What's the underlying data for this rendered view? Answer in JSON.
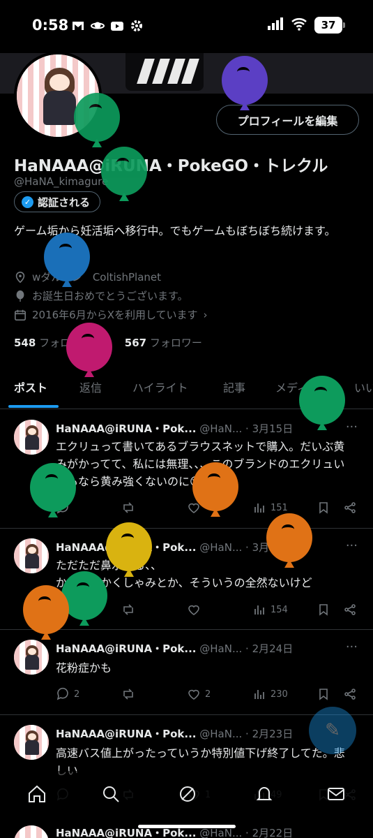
{
  "status_bar": {
    "time": "0:58",
    "battery": "37"
  },
  "profile": {
    "edit_button": "プロフィールを編集",
    "name": "HaNAAA@iRUNA・PokeGO・トレクル",
    "handle": "@HaNA_kimagure",
    "verified_label": "認証される",
    "bio": "ゲーム垢から妊活垢へ移行中。でもゲームもぼちぼち続けます。",
    "location": "wダルカン　ColtishPlanet",
    "birthday": "お誕生日おめでとうございます。",
    "joined": "2016年6月からXを利用しています",
    "following_count": "548",
    "following_label": "フォロー中",
    "followers_count": "567",
    "followers_label": "フォロワー"
  },
  "tabs": [
    "ポスト",
    "返信",
    "ハイライト",
    "記事",
    "メディア",
    "いい"
  ],
  "posts": [
    {
      "name": "HaNAAA@iRUNA・Pok...",
      "handle": "@HaN...",
      "date": "· 3月15日",
      "text": "エクリュって書いてあるブラウスネットで購入。だいぶ黄みがかってて、私には無理、、、このブランドのエクリュいつもなら黄み強くないのに😢",
      "views": "151",
      "likes": "",
      "replies": ""
    },
    {
      "name": "HaNAAA@iRUNA・Pok...",
      "handle": "@HaN...",
      "date": "· 3月1日",
      "text": "ただただ鼻水出る、、\nかゆいとかくしゃみとか、そういうの全然ないけど",
      "views": "154",
      "likes": "",
      "replies": ""
    },
    {
      "name": "HaNAAA@iRUNA・Pok...",
      "handle": "@HaN...",
      "date": "· 2月24日",
      "text": "花粉症かも",
      "views": "230",
      "likes": "2",
      "replies": "2"
    },
    {
      "name": "HaNAAA@iRUNA・Pok...",
      "handle": "@HaN...",
      "date": "· 2月23日",
      "text": "高速バス値上がったっていうか特別値下げ終了してた。悲しい",
      "views": "49",
      "likes": "1",
      "replies": ""
    },
    {
      "name": "HaNAAA@iRUNA・Pok...",
      "handle": "@HaN...",
      "date": "· 2月22日",
      "text": ""
    }
  ],
  "colors": {
    "background": "#000000",
    "accent": "#1d9bf0",
    "balloon_colors": [
      "#5b3fc4",
      "#0d9b5c",
      "#1a6fb8",
      "#c01a6f",
      "#e07216",
      "#d9b310"
    ]
  }
}
